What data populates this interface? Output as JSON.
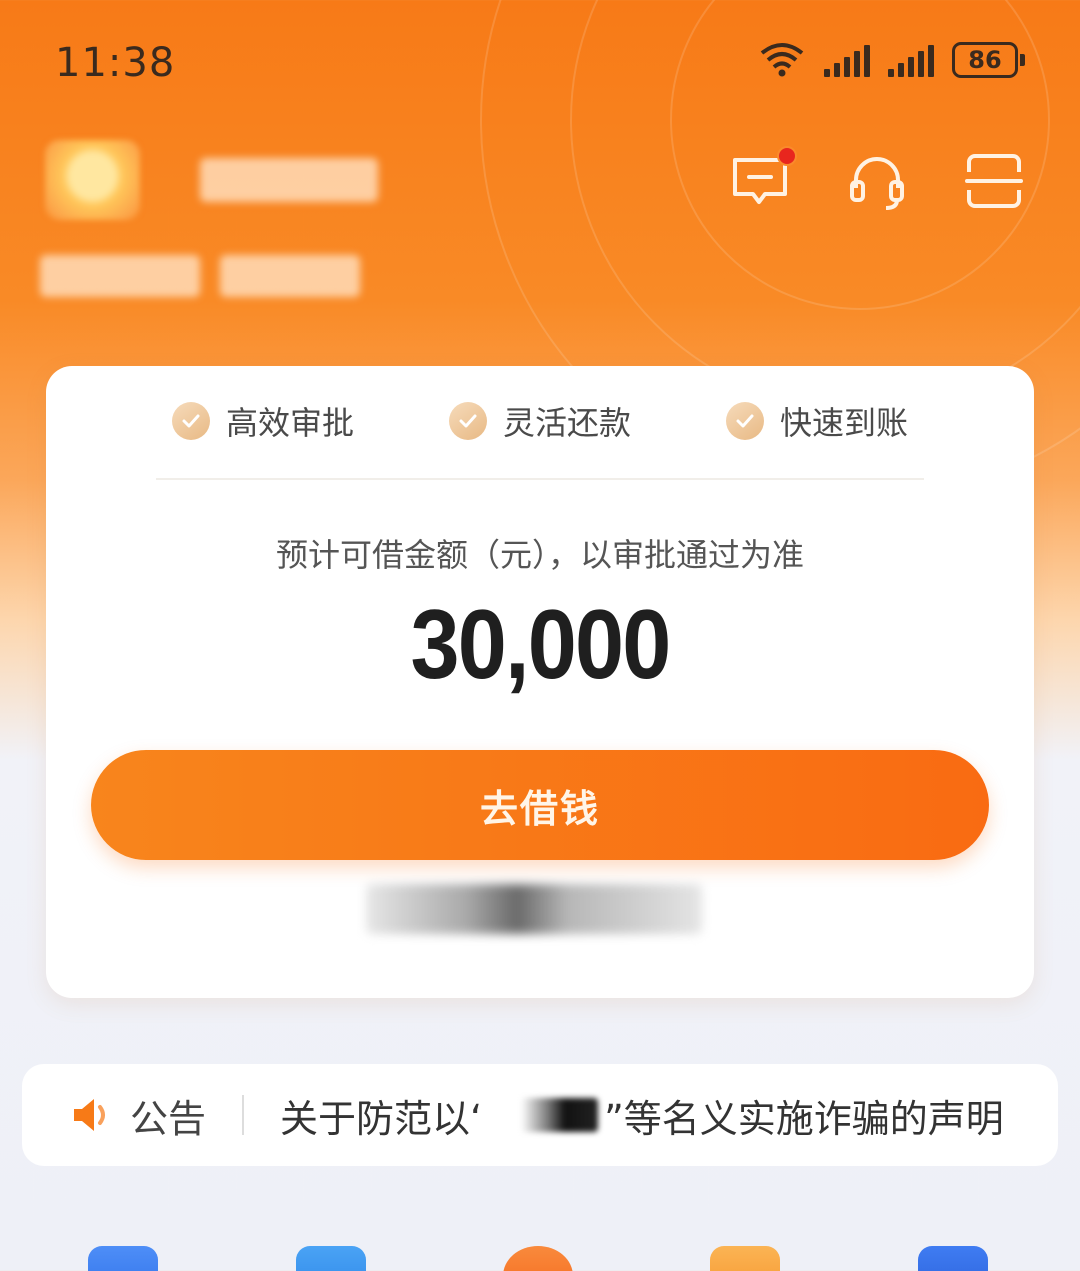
{
  "status_bar": {
    "time": "11:38",
    "battery": "86"
  },
  "header": {
    "icons": [
      "message-icon",
      "headset-icon",
      "scan-icon"
    ]
  },
  "card": {
    "features": [
      {
        "label": "高效审批"
      },
      {
        "label": "灵活还款"
      },
      {
        "label": "快速到账"
      }
    ],
    "amount_caption": "预计可借金额（元），以审批通过为准",
    "amount": "30,000",
    "button_label": "去借钱"
  },
  "notice": {
    "tag": "公告",
    "text_before": "关于防范以‘",
    "text_after": "”等名义实施诈骗的声明"
  },
  "colors": {
    "brand_orange": "#f77a17",
    "button_orange": "#f96b12",
    "notification_dot": "#e8261e"
  }
}
